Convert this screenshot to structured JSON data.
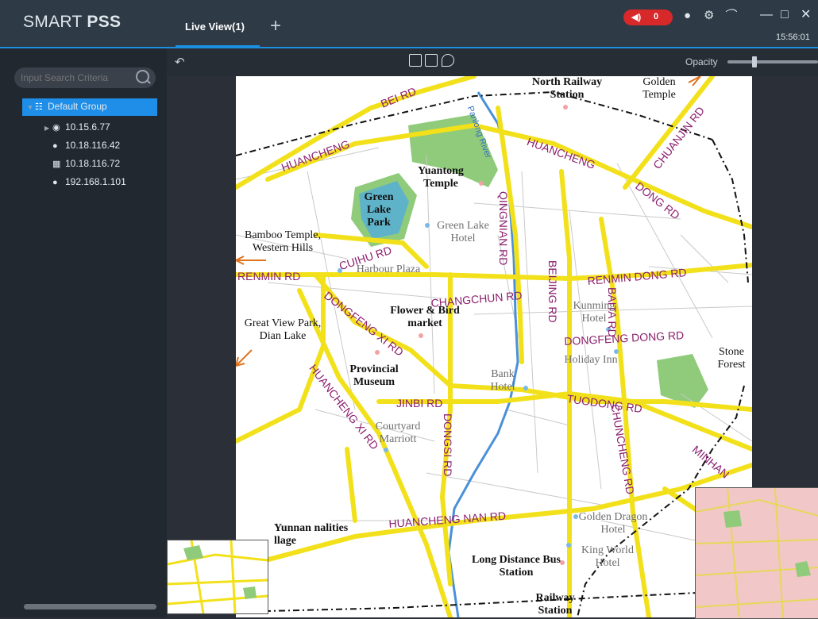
{
  "app": {
    "title_regular": "SMART ",
    "title_bold": "PSS"
  },
  "tabs": [
    {
      "label": "Live View(1)"
    }
  ],
  "add_tab_symbol": "+",
  "alarm": {
    "count": "0",
    "icon": "speaker-icon"
  },
  "clock": "15:56:01",
  "toolbar_icons": [
    "user-icon",
    "gear-icon",
    "speed-icon"
  ],
  "search": {
    "placeholder": "Input Search Criteria"
  },
  "device_tree": {
    "group_label": "Default Group",
    "devices": [
      {
        "label": "10.15.6.77",
        "icon": "camera-icon"
      },
      {
        "label": "10.18.116.42",
        "icon": "offline-camera-icon"
      },
      {
        "label": "10.18.116.72",
        "icon": "nvr-icon"
      },
      {
        "label": "192.168.1.101",
        "icon": "offline-camera-icon"
      }
    ]
  },
  "map_toolbar": {
    "opacity_label": "Opacity",
    "opacity_level": 0.3
  },
  "map": {
    "places": [
      {
        "text": "North Railway Station"
      },
      {
        "text": "Golden Temple"
      },
      {
        "text": "Yuantong Temple"
      },
      {
        "text": "Green Lake Park"
      },
      {
        "text": "Green Lake Hotel"
      },
      {
        "text": "Bamboo Temple, Western Hills"
      },
      {
        "text": "Harbour Plaza"
      },
      {
        "text": "Flower & Bird market"
      },
      {
        "text": "Great View Park, Dian Lake"
      },
      {
        "text": "Kunming Hotel"
      },
      {
        "text": "Holiday Inn"
      },
      {
        "text": "Stone Forest"
      },
      {
        "text": "Provincial Museum"
      },
      {
        "text": "Bank Hotel"
      },
      {
        "text": "Courtyard Marriott"
      },
      {
        "text": "Golden Dragon Hotel"
      },
      {
        "text": "King World Hotel"
      },
      {
        "text": "Yunnan nalities llage"
      },
      {
        "text": "Long Distance Bus Station"
      },
      {
        "text": "Railway Station"
      }
    ],
    "roads": [
      {
        "text": "BEI RD"
      },
      {
        "text": "HUANCHENG"
      },
      {
        "text": "HUANCHENG"
      },
      {
        "text": "CHUANJIN RD"
      },
      {
        "text": "DONG RD"
      },
      {
        "text": "Panlong River"
      },
      {
        "text": "QINGNIAN RD"
      },
      {
        "text": "CUIHU RD"
      },
      {
        "text": "RENMIN RD"
      },
      {
        "text": "CHANGCHUN RD"
      },
      {
        "text": "RENMIN DONG RD"
      },
      {
        "text": "BEIJING RD"
      },
      {
        "text": "DONGFENG XI RD"
      },
      {
        "text": "DONGFENG DONG RD"
      },
      {
        "text": "BAITA RD"
      },
      {
        "text": "HUANCHENG XI RD"
      },
      {
        "text": "JINBI RD"
      },
      {
        "text": "TUODONG RD"
      },
      {
        "text": "DONGSI RD"
      },
      {
        "text": "CHUNCHENG RD"
      },
      {
        "text": "MINHAN"
      },
      {
        "text": "HUANCHENG NAN RD"
      }
    ]
  }
}
